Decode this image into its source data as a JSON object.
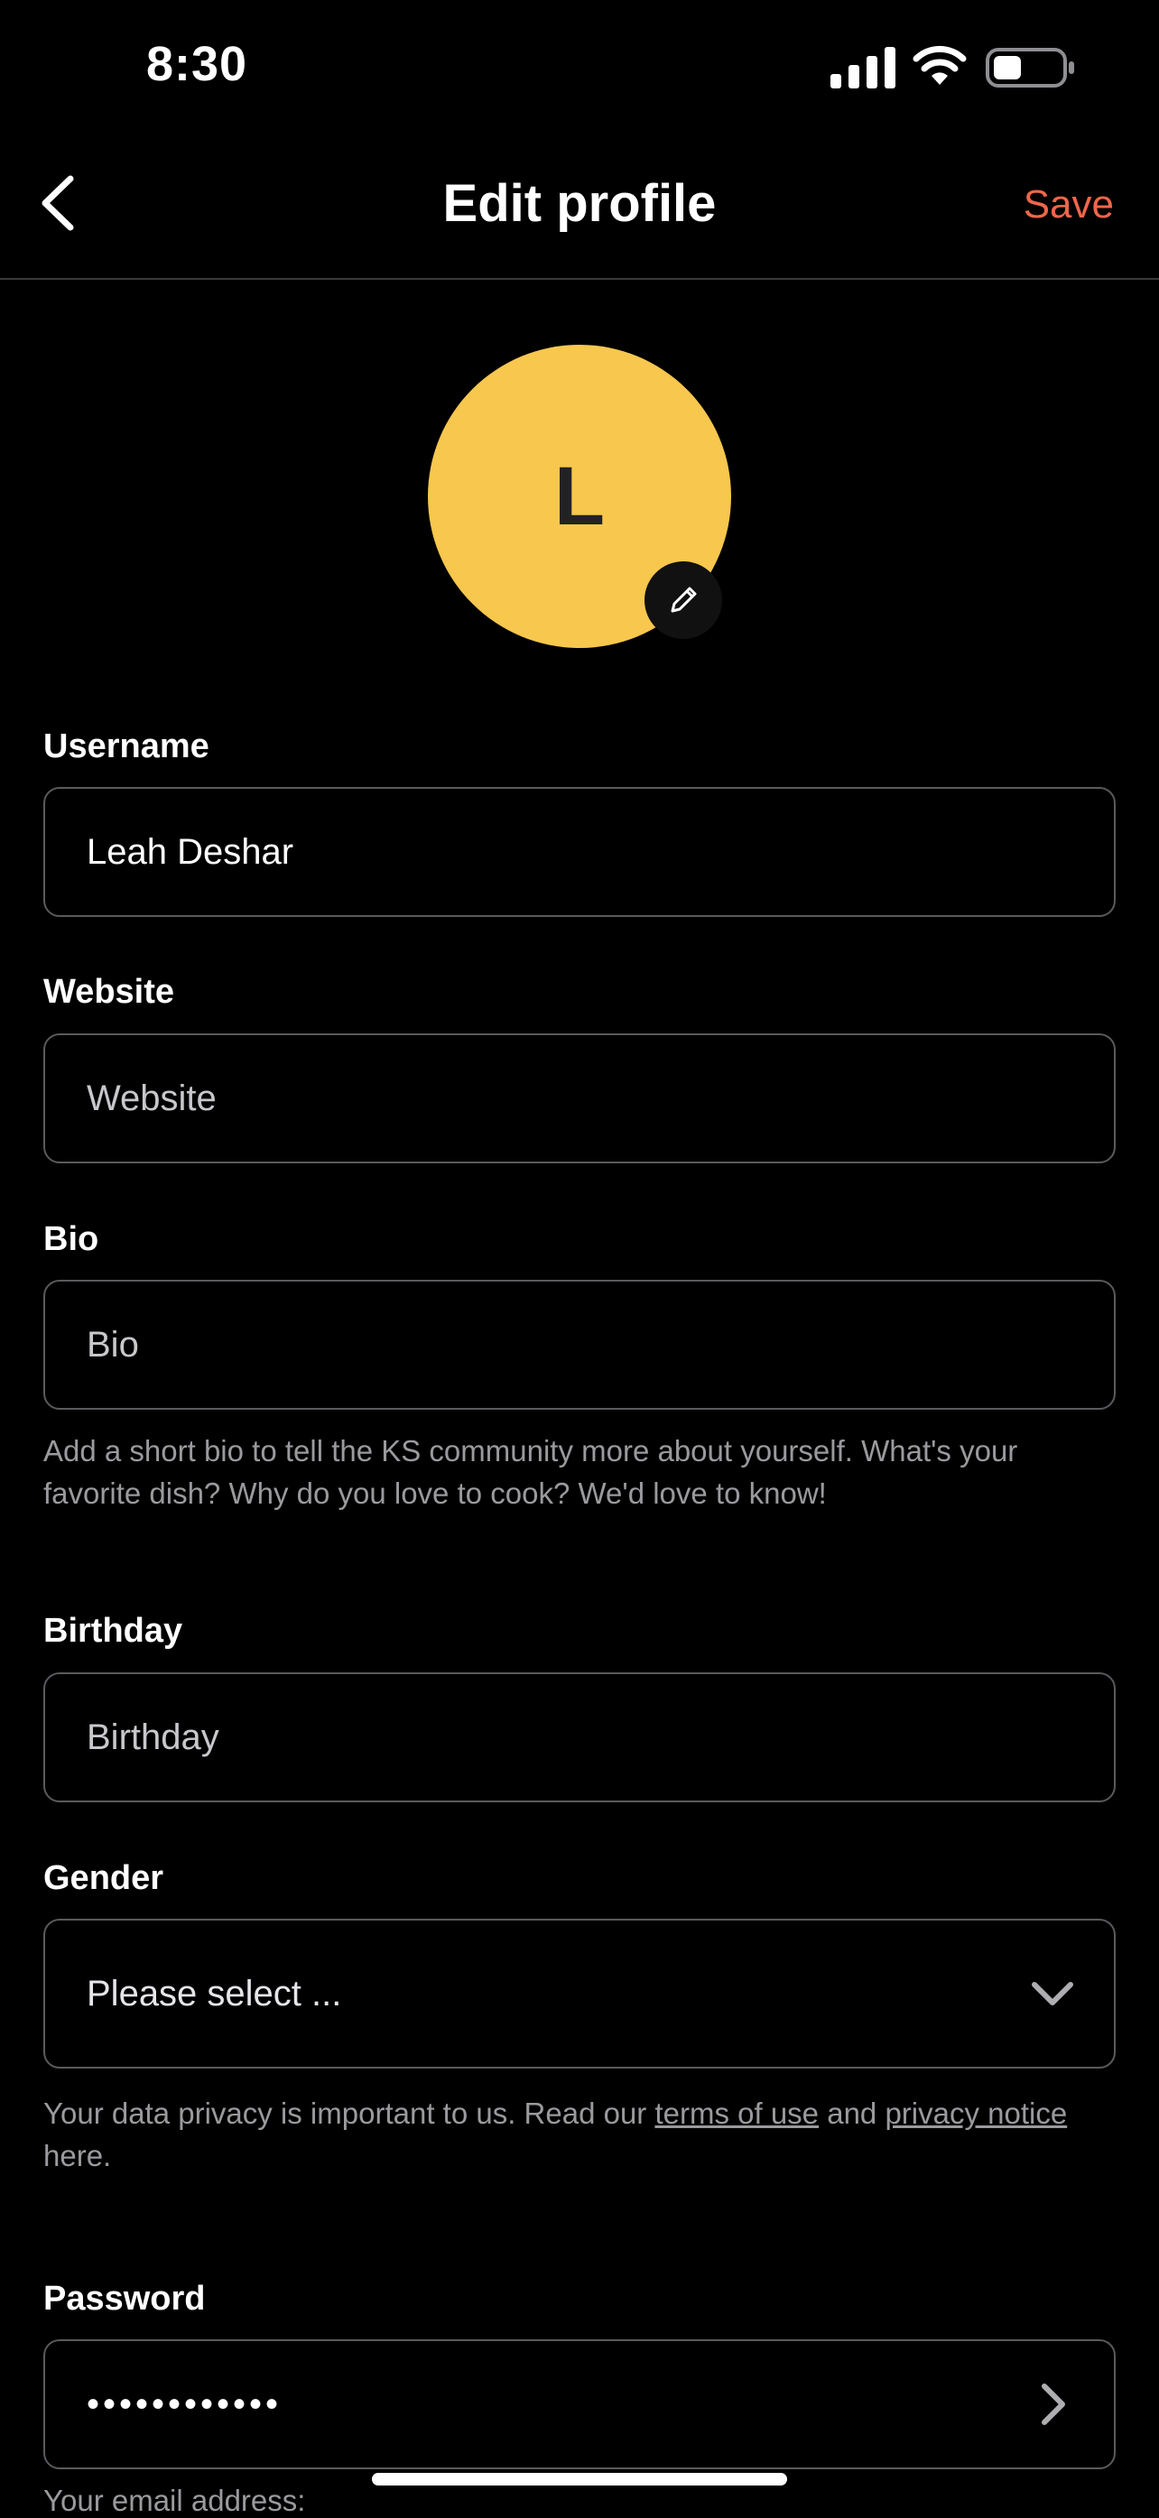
{
  "status_bar": {
    "time": "8:30"
  },
  "nav": {
    "title": "Edit profile",
    "save_label": "Save"
  },
  "avatar": {
    "initial": "L",
    "color": "#f7c74e"
  },
  "form": {
    "username": {
      "label": "Username",
      "value": "Leah Deshar",
      "placeholder": "Username"
    },
    "website": {
      "label": "Website",
      "value": "",
      "placeholder": "Website"
    },
    "bio": {
      "label": "Bio",
      "value": "",
      "placeholder": "Bio",
      "helper": "Add a short bio to tell the KS community more about yourself. What's your favorite dish? Why do you love to cook? We'd love to know!"
    },
    "birthday": {
      "label": "Birthday",
      "value": "",
      "placeholder": "Birthday"
    },
    "gender": {
      "label": "Gender",
      "selected": "Please select ..."
    },
    "privacy": {
      "prefix": "Your data privacy is important to us. Read our ",
      "terms_link": "terms of use",
      "middle": " and ",
      "privacy_link": "privacy notice",
      "suffix": " here."
    },
    "password": {
      "label": "Password",
      "value": "••••••••••••"
    },
    "email_hint": "Your email address:"
  },
  "colors": {
    "accent": "#f0664a",
    "background": "#000000"
  }
}
